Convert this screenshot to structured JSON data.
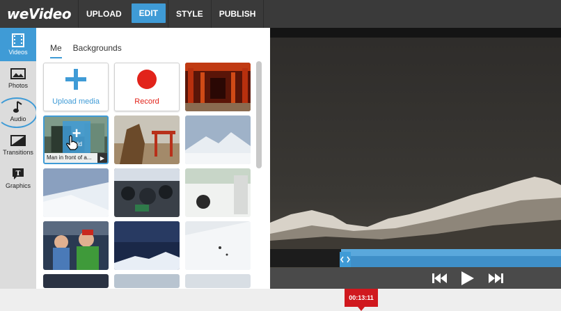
{
  "app": {
    "logo": "weVideo"
  },
  "nav": {
    "tabs": [
      "UPLOAD",
      "EDIT",
      "STYLE",
      "PUBLISH"
    ],
    "active": "EDIT"
  },
  "sidebar": {
    "items": [
      {
        "label": "Videos",
        "icon": "film-icon",
        "active": true
      },
      {
        "label": "Photos",
        "icon": "photo-icon",
        "active": false
      },
      {
        "label": "Audio",
        "icon": "music-note-icon",
        "active": false
      },
      {
        "label": "Transitions",
        "icon": "transition-icon",
        "active": false
      },
      {
        "label": "Graphics",
        "icon": "text-graphics-icon",
        "active": false
      }
    ]
  },
  "library": {
    "tabs": [
      "Me",
      "Backgrounds"
    ],
    "active_tab": "Me",
    "upload_label": "Upload media",
    "record_label": "Record",
    "hover_clip_title": "Man in front of a...",
    "hover_add_label": "Add"
  },
  "player": {
    "controls": [
      "skip-back-icon",
      "play-icon",
      "skip-forward-icon"
    ]
  },
  "timeline": {
    "timecode": "00:13:11"
  },
  "colors": {
    "accent": "#3f9bd6",
    "record": "#e2231a",
    "topbar": "#3a3a3a",
    "timecode": "#d0181e"
  }
}
